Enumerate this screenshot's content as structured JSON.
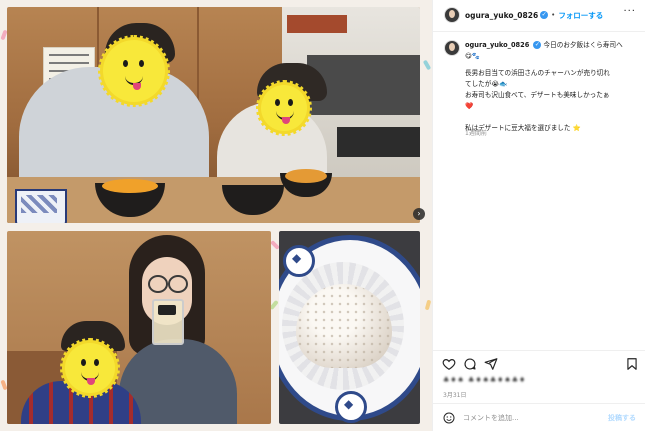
{
  "post": {
    "username": "ogura_yuko_0826",
    "follow_label": "フォローする",
    "separator": "•",
    "more": "···",
    "caption_first": "今日のお夕飯はくら寿司へ",
    "caption_first_2": "😋🐾",
    "caption_lines": [
      "長男お目当ての浜田さんのチャーハンが売り切れ",
      "てしたが😭🐟",
      "お寿司も沢山食べて、デザートも美味しかったぁ",
      "❤️",
      "",
      "私はデザートに豆大福を選びました ⭐"
    ],
    "time_ago": "1週間前",
    "likes_text": "♣♦♠ ♣♦♠♣♦♠♣♦",
    "date": "3月31日",
    "comment_placeholder": "コメントを追加...",
    "post_button": "投稿する"
  },
  "icons": {
    "heart": "heart-icon",
    "comment": "comment-icon",
    "share": "share-icon",
    "bookmark": "bookmark-icon",
    "emoji": "emoji-icon",
    "more": "more-icon",
    "next": "chevron-right-icon"
  },
  "colors": {
    "link_blue": "#0095f6",
    "verified_blue": "#3797f0",
    "muted": "#8e8e8e"
  }
}
